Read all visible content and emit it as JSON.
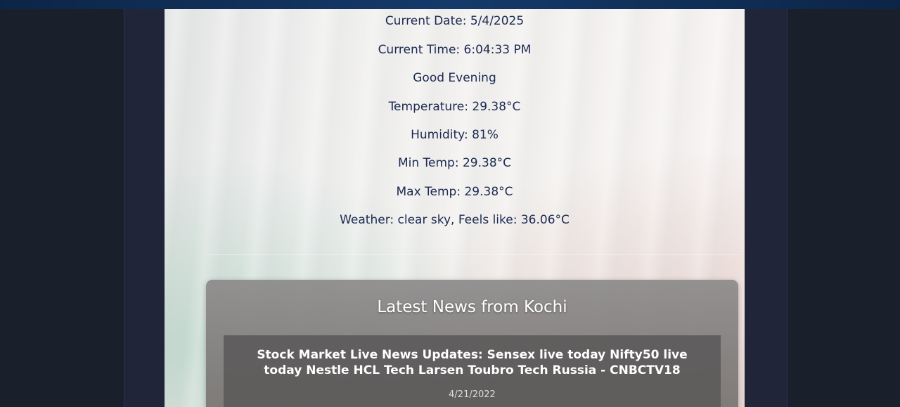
{
  "weather": {
    "current_date": "Current Date: 5/4/2025",
    "current_time": "Current Time: 6:04:33 PM",
    "greeting": "Good Evening",
    "temperature": "Temperature: 29.38°C",
    "humidity": "Humidity: 81%",
    "min_temp": "Min Temp: 29.38°C",
    "max_temp": "Max Temp: 29.38°C",
    "conditions": "Weather: clear sky, Feels like: 36.06°C"
  },
  "news": {
    "heading": "Latest News from Kochi",
    "articles": [
      {
        "headline": "Stock Market Live News Updates: Sensex live today Nifty50 live today Nestle HCL Tech Larsen Toubro Tech Russia - CNBCTV18",
        "date": "4/21/2022"
      }
    ]
  },
  "colors": {
    "page_background": "#1a1f2c",
    "text_primary": "#1b2a52",
    "news_text": "#ffffff"
  }
}
